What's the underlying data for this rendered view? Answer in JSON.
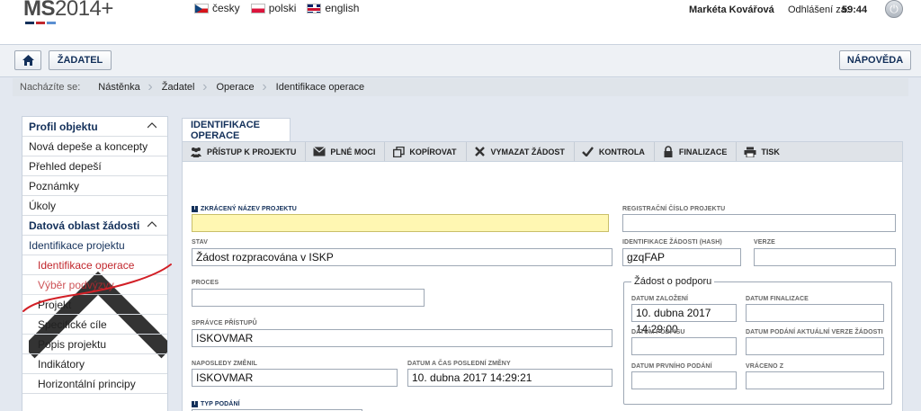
{
  "header": {
    "logo_bold": "MS",
    "logo_rest": "2014+",
    "languages": [
      "česky",
      "polski",
      "english"
    ],
    "user_name": "Markéta Kovářová",
    "logout_label": "Odhlášení za:",
    "logout_time": "59:44"
  },
  "nav": {
    "applicant_label": "ŽADATEL",
    "help_label": "NÁPOVĚDA"
  },
  "breadcrumb": {
    "lead": "Nacházíte se:",
    "items": [
      "Nástěnka",
      "Žadatel",
      "Operace",
      "Identifikace operace"
    ]
  },
  "sidebar": {
    "items": [
      "Profil objektu",
      "Nová depeše a koncepty",
      "Přehled depeší",
      "Poznámky",
      "Úkoly",
      "Datová oblast žádosti",
      "Identifikace projektu",
      "Identifikace operace",
      "Výběr podvýzvy",
      "Projekt",
      "Specifické cíle",
      "Popis projektu",
      "Indikátory",
      "Horizontální principy"
    ]
  },
  "main": {
    "tab_label": "IDENTIFIKACE OPERACE",
    "toolbar": [
      "PŘÍSTUP K PROJEKTU",
      "PLNÉ MOCI",
      "KOPÍROVAT",
      "VYMAZAT ŽÁDOST",
      "KONTROLA",
      "FINALIZACE",
      "TISK"
    ]
  },
  "form": {
    "short_name_label": "ZKRÁCENÝ NÁZEV PROJEKTU",
    "short_name_value": "",
    "reg_number_label": "REGISTRAČNÍ ČÍSLO PROJEKTU",
    "reg_number_value": "",
    "status_label": "STAV",
    "status_value": "Žádost rozpracována v ISKP",
    "hash_label": "IDENTIFIKACE ŽÁDOSTI (HASH)",
    "hash_value": "gzqFAP",
    "version_label": "VERZE",
    "version_value": "",
    "process_label": "PROCES",
    "process_value": "",
    "access_admin_label": "SPRÁVCE PŘÍSTUPŮ",
    "access_admin_value": "ISKOVMAR",
    "last_changed_by_label": "NAPOSLEDY ZMĚNIL",
    "last_changed_by_value": "ISKOVMAR",
    "last_change_date_label": "DATUM A ČAS POSLEDNÍ ZMĚNY",
    "last_change_date_value": "10. dubna 2017 14:29:21",
    "submission_type_label": "TYP PODÁNÍ",
    "support_request": {
      "legend": "Žádost o podporu",
      "created_label": "DATUM ZALOŽENÍ",
      "created_value": "10. dubna 2017 14:29:00",
      "finalized_label": "DATUM FINALIZACE",
      "finalized_value": "",
      "signed_label": "DATUM PODPISU",
      "signed_value": "",
      "current_version_label": "DATUM PODÁNÍ AKTUÁLNÍ VERZE ŽÁDOSTI",
      "current_version_value": "",
      "first_submission_label": "DATUM PRVNÍHO PODÁNÍ",
      "first_submission_value": "",
      "returned_label": "VRÁCENO Z",
      "returned_value": ""
    }
  },
  "colors": {
    "accent_navy": "#13305a",
    "active_red": "#c1272d",
    "required_yellow": "#fff7b2"
  }
}
